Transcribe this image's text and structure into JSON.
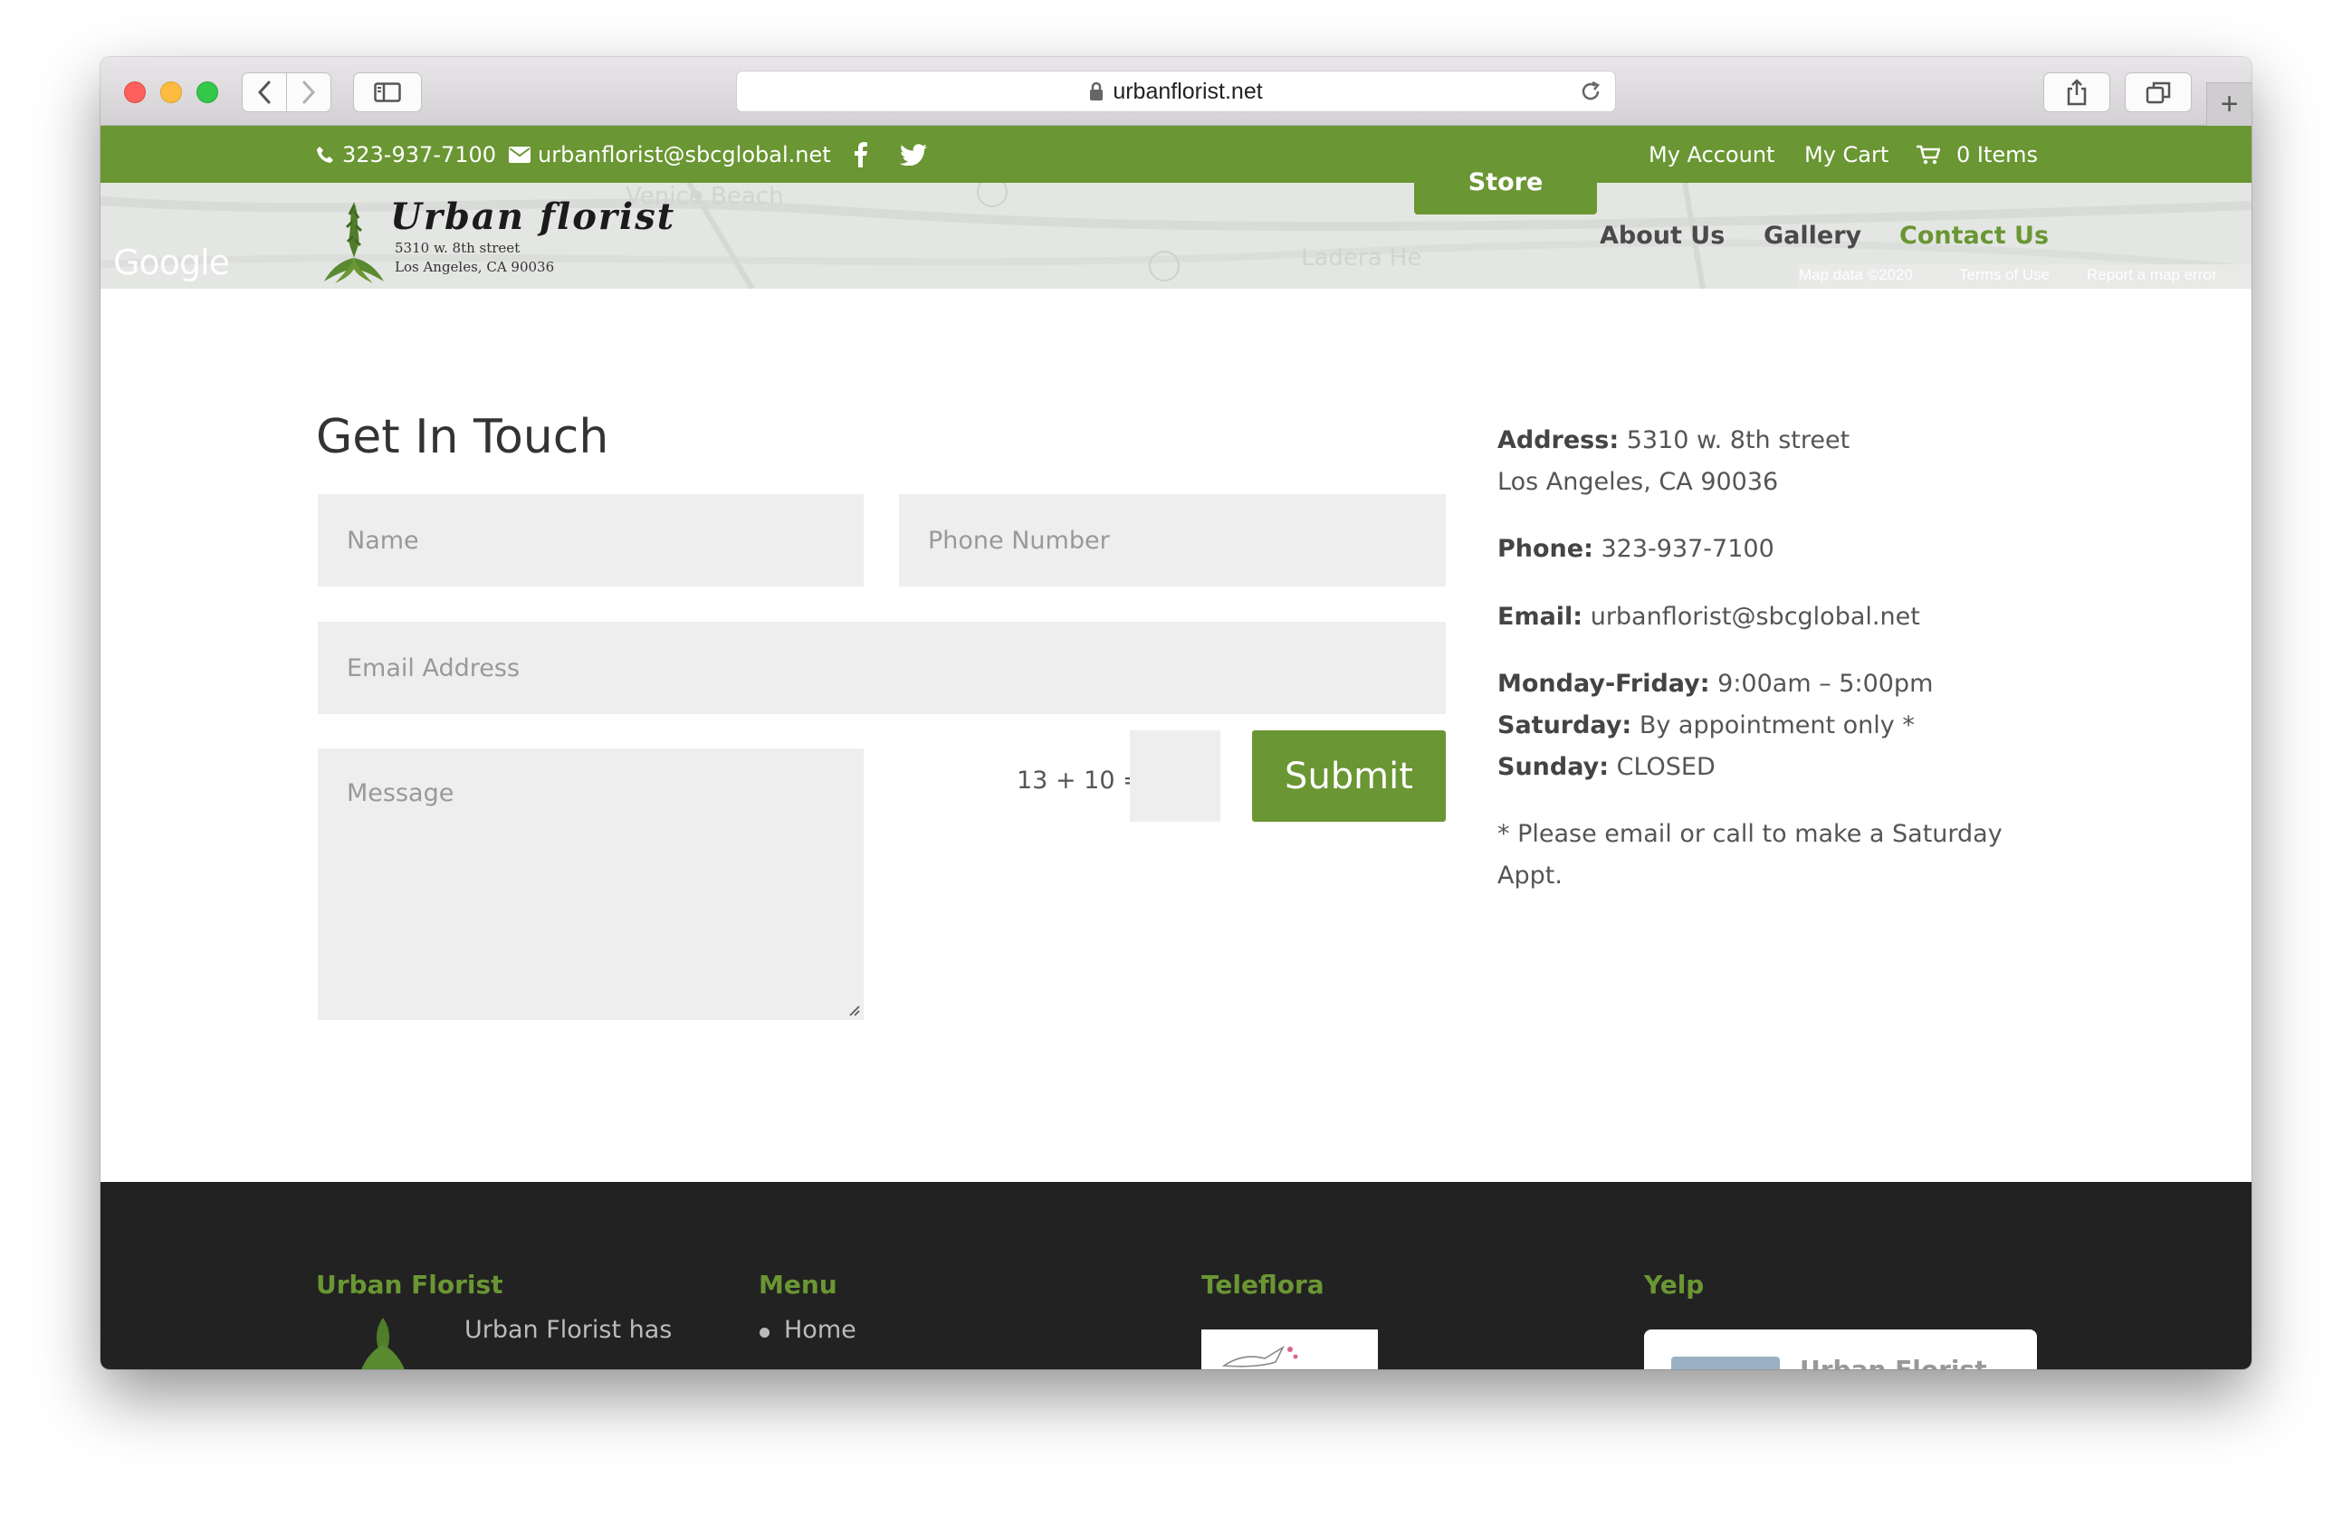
{
  "browser": {
    "url": "urbanflorist.net"
  },
  "topbar": {
    "phone": "323-937-7100",
    "email": "urbanflorist@sbcglobal.net",
    "my_account": "My Account",
    "my_cart": "My Cart",
    "items": "0 Items"
  },
  "map": {
    "google": "Google",
    "place_venice_beach": "Venice Beach",
    "place_ladera": "Ladera He",
    "map_data": "Map data ©2020",
    "terms": "Terms of Use",
    "report": "Report a map error"
  },
  "logo": {
    "title": "Urban florist",
    "address_line1": "5310 w. 8th street",
    "address_line2": "Los Angeles, CA 90036"
  },
  "nav": {
    "store": "Store",
    "about": "About Us",
    "gallery": "Gallery",
    "contact": "Contact Us"
  },
  "form": {
    "heading": "Get In Touch",
    "name_placeholder": "Name",
    "phone_placeholder": "Phone Number",
    "email_placeholder": "Email Address",
    "message_placeholder": "Message",
    "captcha_question": "13 + 10 =",
    "submit": "Submit"
  },
  "contact_info": {
    "address_label": "Address:",
    "address_line1": "5310 w. 8th street",
    "address_line2": "Los Angeles, CA 90036",
    "phone_label": "Phone:",
    "phone": "323-937-7100",
    "email_label": "Email:",
    "email": "urbanflorist@sbcglobal.net",
    "weekday_label": "Monday-Friday:",
    "weekday_hours": "9:00am – 5:00pm",
    "saturday_label": "Saturday:",
    "saturday_hours": "By appointment only *",
    "sunday_label": "Sunday:",
    "sunday_hours": "CLOSED",
    "note_line1": "* Please email or call to make a Saturday",
    "note_line2": "Appt."
  },
  "footer": {
    "col1_title": "Urban Florist",
    "col1_text": "Urban Florist has",
    "col2_title": "Menu",
    "col2_item": "Home",
    "col3_title": "Teleflora",
    "col4_title": "Yelp",
    "yelp_name": "Urban Florist"
  },
  "colors": {
    "brand_green": "#6a9633",
    "footer_bg": "#222222",
    "field_bg": "#eeeeee"
  }
}
